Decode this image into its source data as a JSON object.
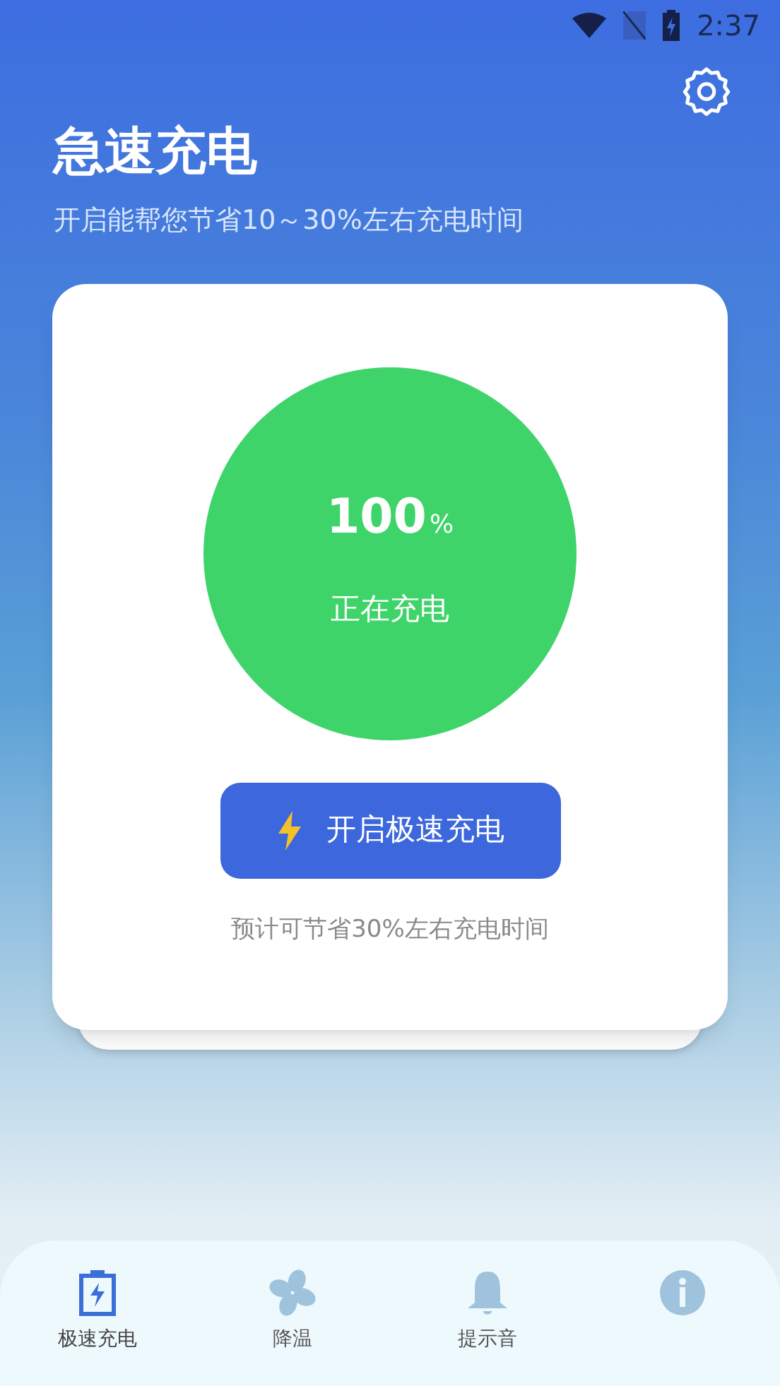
{
  "status_bar": {
    "time": "2:37"
  },
  "header": {
    "title": "急速充电",
    "subtitle": "开启能帮您节省10～30%左右充电时间"
  },
  "charge": {
    "percent": "100",
    "unit": "%",
    "status": "正在充电"
  },
  "action_button": {
    "label": "开启极速充电"
  },
  "note": "预计可节省30%左右充电时间",
  "tabs": [
    {
      "kind": "battery",
      "label": "极速充电",
      "selected": true
    },
    {
      "kind": "fan",
      "label": "降温",
      "selected": false
    },
    {
      "kind": "bell",
      "label": "提示音",
      "selected": false
    },
    {
      "kind": "info",
      "selected": false
    }
  ]
}
